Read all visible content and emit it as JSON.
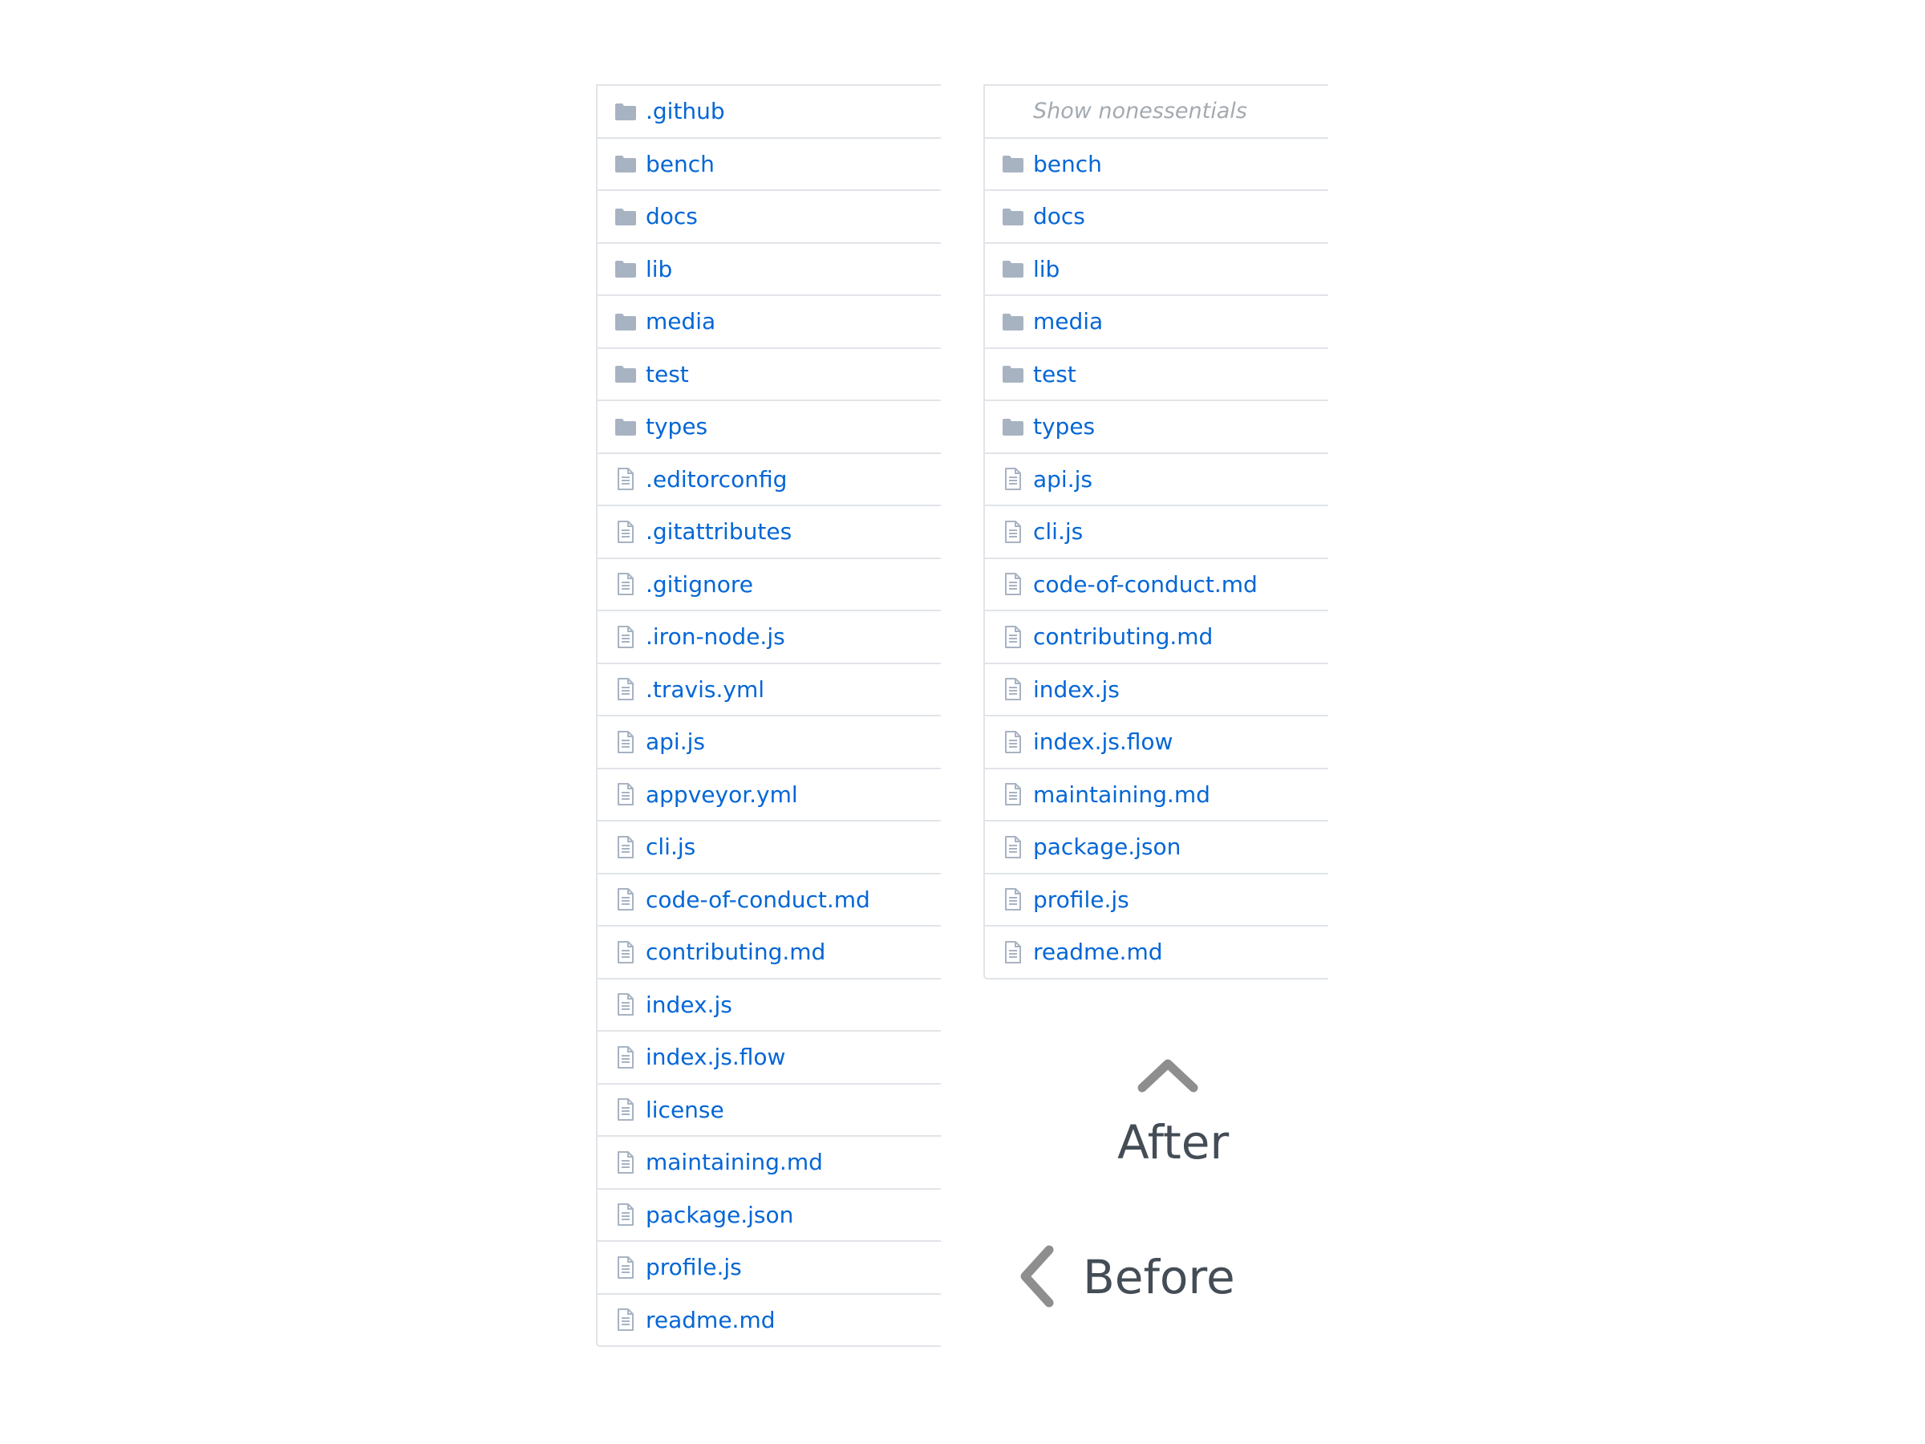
{
  "before": {
    "items": [
      {
        "type": "folder",
        "name": ".github"
      },
      {
        "type": "folder",
        "name": "bench"
      },
      {
        "type": "folder",
        "name": "docs"
      },
      {
        "type": "folder",
        "name": "lib"
      },
      {
        "type": "folder",
        "name": "media"
      },
      {
        "type": "folder",
        "name": "test"
      },
      {
        "type": "folder",
        "name": "types"
      },
      {
        "type": "file",
        "name": ".editorconfig"
      },
      {
        "type": "file",
        "name": ".gitattributes"
      },
      {
        "type": "file",
        "name": ".gitignore"
      },
      {
        "type": "file",
        "name": ".iron-node.js"
      },
      {
        "type": "file",
        "name": ".travis.yml"
      },
      {
        "type": "file",
        "name": "api.js"
      },
      {
        "type": "file",
        "name": "appveyor.yml"
      },
      {
        "type": "file",
        "name": "cli.js"
      },
      {
        "type": "file",
        "name": "code-of-conduct.md"
      },
      {
        "type": "file",
        "name": "contributing.md"
      },
      {
        "type": "file",
        "name": "index.js"
      },
      {
        "type": "file",
        "name": "index.js.flow"
      },
      {
        "type": "file",
        "name": "license"
      },
      {
        "type": "file",
        "name": "maintaining.md"
      },
      {
        "type": "file",
        "name": "package.json"
      },
      {
        "type": "file",
        "name": "profile.js"
      },
      {
        "type": "file",
        "name": "readme.md"
      }
    ]
  },
  "after": {
    "toggle_label": "Show nonessentials",
    "items": [
      {
        "type": "folder",
        "name": "bench"
      },
      {
        "type": "folder",
        "name": "docs"
      },
      {
        "type": "folder",
        "name": "lib"
      },
      {
        "type": "folder",
        "name": "media"
      },
      {
        "type": "folder",
        "name": "test"
      },
      {
        "type": "folder",
        "name": "types"
      },
      {
        "type": "file",
        "name": "api.js"
      },
      {
        "type": "file",
        "name": "cli.js"
      },
      {
        "type": "file",
        "name": "code-of-conduct.md"
      },
      {
        "type": "file",
        "name": "contributing.md"
      },
      {
        "type": "file",
        "name": "index.js"
      },
      {
        "type": "file",
        "name": "index.js.flow"
      },
      {
        "type": "file",
        "name": "maintaining.md"
      },
      {
        "type": "file",
        "name": "package.json"
      },
      {
        "type": "file",
        "name": "profile.js"
      },
      {
        "type": "file",
        "name": "readme.md"
      }
    ]
  },
  "annotations": {
    "after_label": "After",
    "before_label": "Before"
  },
  "icons": {
    "folder": "folder-icon",
    "file": "file-icon",
    "up": "chevron-up-icon",
    "left": "chevron-left-icon"
  },
  "colors": {
    "link": "#0366d6",
    "icon": "#a8b3c2",
    "border": "#e1e4e8",
    "muted": "#a3aab1",
    "annotation": "#444d56",
    "chevron": "#8e8e8e"
  }
}
